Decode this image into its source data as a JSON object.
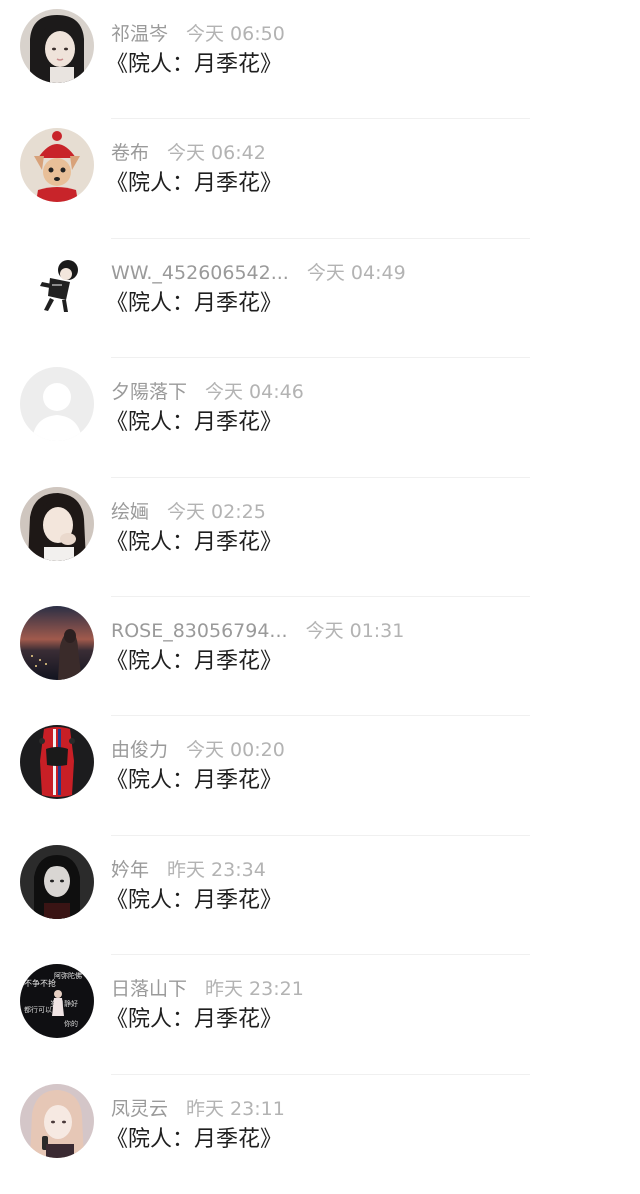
{
  "comments": [
    {
      "name": "祁温岑",
      "time": "今天 06:50",
      "message": "《院人：月季花》",
      "avatar": "avatar-girl-dark-hair"
    },
    {
      "name": "卷布",
      "time": "今天 06:42",
      "message": "《院人：月季花》",
      "avatar": "avatar-dog-red-hat"
    },
    {
      "name": "WW._452606542...",
      "time": "今天 04:49",
      "message": "《院人：月季花》",
      "avatar": "avatar-cartoon-boy"
    },
    {
      "name": "夕陽落下",
      "time": "今天 04:46",
      "message": "《院人：月季花》",
      "avatar": "avatar-default-silhouette"
    },
    {
      "name": "绘婳",
      "time": "今天 02:25",
      "message": "《院人：月季花》",
      "avatar": "avatar-girl-portrait"
    },
    {
      "name": "ROSE_83056794...",
      "time": "今天 01:31",
      "message": "《院人：月季花》",
      "avatar": "avatar-night-city"
    },
    {
      "name": "由俊力",
      "time": "今天 00:20",
      "message": "《院人：月季花》",
      "avatar": "avatar-red-car"
    },
    {
      "name": "妗年",
      "time": "昨天 23:34",
      "message": "《院人：月季花》",
      "avatar": "avatar-girl-bw"
    },
    {
      "name": "日落山下",
      "time": "昨天 23:21",
      "message": "《院人：月季花》",
      "avatar": "avatar-text-collage",
      "avatar_text": [
        "不争不抢",
        "阿弥陀佛",
        "岁月静好",
        "都行可以",
        "你的"
      ]
    },
    {
      "name": "凤灵云",
      "time": "昨天 23:11",
      "message": "《院人：月季花》",
      "avatar": "avatar-girl-singer"
    }
  ]
}
